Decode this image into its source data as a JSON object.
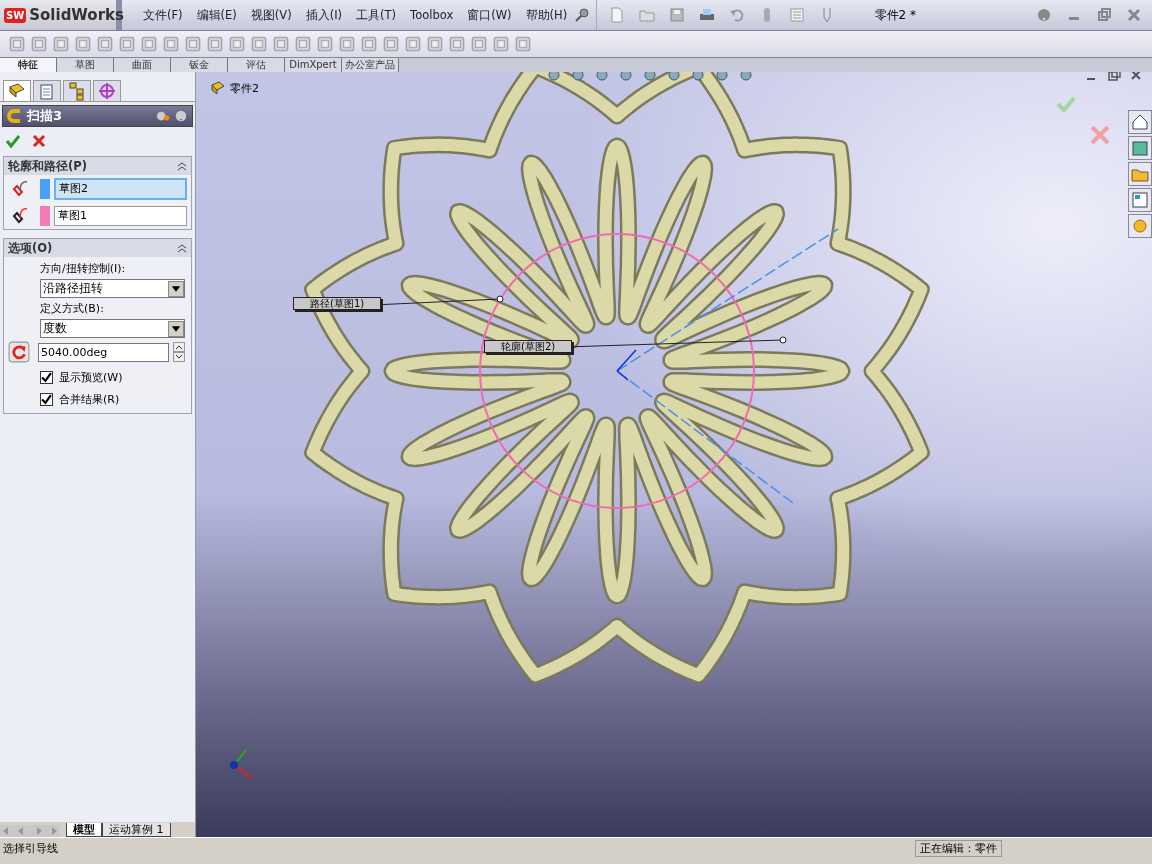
{
  "app": {
    "logo_badge": "SW",
    "logo_text": "SolidWorks"
  },
  "menu": [
    "文件(F)",
    "编辑(E)",
    "视图(V)",
    "插入(I)",
    "工具(T)",
    "Toolbox",
    "窗口(W)",
    "帮助(H)"
  ],
  "document_title": "零件2 *",
  "command_tabs": [
    {
      "label": "特征",
      "selected": true
    },
    {
      "label": "草图",
      "selected": false
    },
    {
      "label": "曲面",
      "selected": false
    },
    {
      "label": "钣金",
      "selected": false
    },
    {
      "label": "评估",
      "selected": false
    },
    {
      "label": "DimXpert",
      "selected": false
    },
    {
      "label": "办公室产品",
      "selected": false
    }
  ],
  "property_manager": {
    "title": "扫描3",
    "profile_group": {
      "title": "轮廓和路径(P)",
      "selections": [
        {
          "value": "草图2",
          "color": "#4a9ff5",
          "selected": true
        },
        {
          "value": "草图1",
          "color": "#f57ab8",
          "selected": false
        }
      ]
    },
    "options_group": {
      "title": "选项(O)",
      "orientation_label": "方向/扭转控制(I):",
      "orientation_value": "沿路径扭转",
      "define_label": "定义方式(B):",
      "define_value": "度数",
      "angle_value": "5040.00deg",
      "checkboxes": [
        {
          "label": "显示预览(W)",
          "checked": true
        },
        {
          "label": "合并结果(R)",
          "checked": true
        }
      ]
    }
  },
  "viewport": {
    "tree_root": "零件2",
    "callouts": [
      {
        "label": "路径(草图1)"
      },
      {
        "label": "轮廓(草图2)"
      }
    ]
  },
  "bottom_tabs": [
    {
      "label": "模型",
      "selected": true
    },
    {
      "label": "运动算例 1",
      "selected": false
    }
  ],
  "status_bar": {
    "message": "选择引导线",
    "mode": "正在编辑：零件"
  }
}
